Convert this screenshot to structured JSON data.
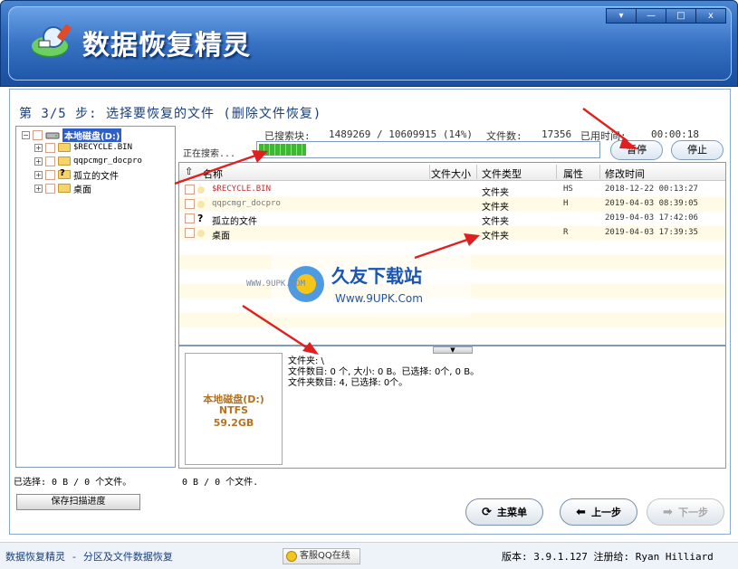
{
  "app": {
    "title": "数据恢复精灵",
    "window_controls": [
      "▾",
      "—",
      "□",
      "x"
    ]
  },
  "step": {
    "title": "第 3/5 步: 选择要恢复的文件 (删除文件恢复)"
  },
  "tree": {
    "root_label": "本地磁盘(D:)",
    "items": [
      {
        "label": "$RECYCLE.BIN"
      },
      {
        "label": "qqpcmgr_docpro"
      },
      {
        "label": "孤立的文件"
      },
      {
        "label": "桌面"
      }
    ]
  },
  "scan": {
    "blocks_label": "已搜索块:",
    "blocks_value": "1489269 / 10609915 (14%)",
    "files_label": "文件数:",
    "files_value": "17356",
    "time_label": "已用时间:",
    "time_value": "00:00:18",
    "searching_label": "正在搜索...",
    "progress": 0.14,
    "pause_label": "暂停",
    "stop_label": "停止"
  },
  "file_table": {
    "columns": {
      "name": "名称",
      "size": "文件大小",
      "type": "文件类型",
      "attr": "属性",
      "modified": "修改时间"
    },
    "rows": [
      {
        "name": "$RECYCLE.BIN",
        "size": "",
        "type": "文件夹",
        "attr": "HS",
        "modified": "2018-12-22 00:13:27"
      },
      {
        "name": "qqpcmgr_docpro",
        "size": "",
        "type": "文件夹",
        "attr": "H",
        "modified": "2019-04-03 08:39:05"
      },
      {
        "name": "孤立的文件",
        "size": "",
        "type": "文件夹",
        "attr": "",
        "modified": "2019-04-03 17:42:06"
      },
      {
        "name": "桌面",
        "size": "",
        "type": "文件夹",
        "attr": "R",
        "modified": "2019-04-03 17:39:35"
      }
    ]
  },
  "info": {
    "disk_name": "本地磁盘(D:)",
    "fs": "NTFS",
    "size": "59.2GB",
    "lines": [
      "文件夹: \\",
      "文件数目: 0 个, 大小: 0 B。已选择: 0个, 0 B。",
      "文件夹数目: 4, 已选择: 0个。"
    ]
  },
  "status": {
    "selected_left": "已选择: 0 B / 0 个文件。",
    "selected_mid": "0 B / 0 个文件."
  },
  "buttons": {
    "save_progress": "保存扫描进度",
    "main_menu": "主菜单",
    "prev": "上一步",
    "next": "下一步"
  },
  "footer": {
    "left": "数据恢复精灵 - 分区及文件数据恢复",
    "qq": "客服QQ在线",
    "right": "版本: 3.9.1.127 注册给: Ryan Hilliard"
  },
  "watermark": {
    "site_cn": "久友下载站",
    "site_url": "Www.9UPK.Com",
    "site_url_small": "WWW.9UPK.COM"
  },
  "colors": {
    "header_blue": "#2a64b8",
    "arrow_red": "#e02020",
    "progress_green": "#3fb634",
    "tree_selected": "#2f5fc4"
  }
}
